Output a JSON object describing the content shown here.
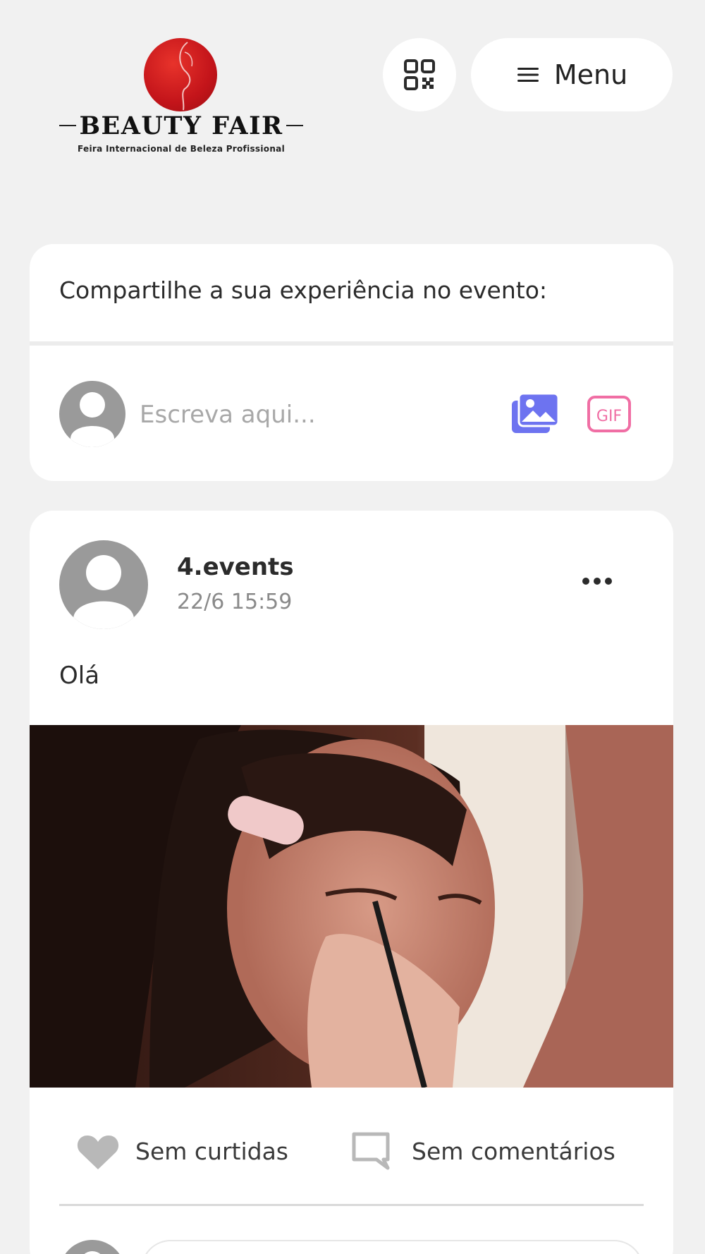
{
  "header": {
    "logo": {
      "brand": "BEAUTY FAIR",
      "subtitle": "Feira Internacional de Beleza Profissional"
    },
    "qr_icon": "qr-code-icon",
    "menu_label": "Menu",
    "menu_icon": "hamburger-icon"
  },
  "composer": {
    "title": "Compartilhe a sua experiência no evento:",
    "placeholder": "Escreva aqui...",
    "image_icon": "image-gallery-icon",
    "gif_icon": "gif-icon",
    "accent_image": "#6d73f0",
    "accent_gif": "#f06ea4"
  },
  "post": {
    "author": "4.events",
    "timestamp": "22/6 15:59",
    "text": "Olá",
    "media": "makeup-gif",
    "likes_label": "Sem curtidas",
    "comments_label": "Sem comentários"
  }
}
